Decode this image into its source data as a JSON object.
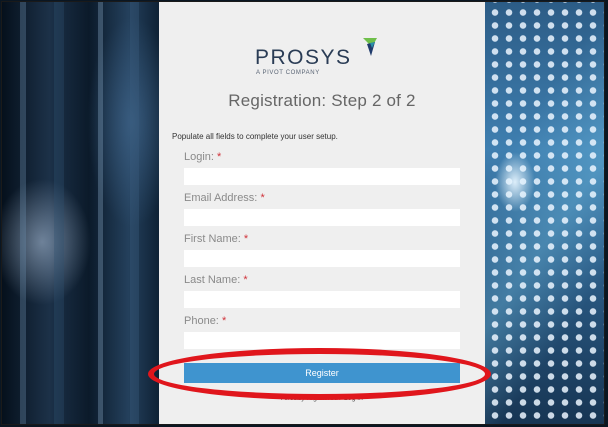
{
  "logo": {
    "wordmark": "PROSYS",
    "tagline": "A PIVOT COMPANY"
  },
  "page": {
    "title": "Registration: Step 2 of 2",
    "instructions": "Populate all fields to complete your user setup."
  },
  "form": {
    "required_marker": "*",
    "fields": [
      {
        "label": "Login:",
        "value": ""
      },
      {
        "label": "Email Address:",
        "value": ""
      },
      {
        "label": "First Name:",
        "value": ""
      },
      {
        "label": "Last Name:",
        "value": ""
      },
      {
        "label": "Phone:",
        "value": ""
      }
    ],
    "register_label": "Register"
  },
  "footer": {
    "text": "Already registered? Log in"
  },
  "colors": {
    "accent": "#3f94cf",
    "required": "#d0323a",
    "annotation": "#e0161c",
    "panel": "#efefef"
  }
}
